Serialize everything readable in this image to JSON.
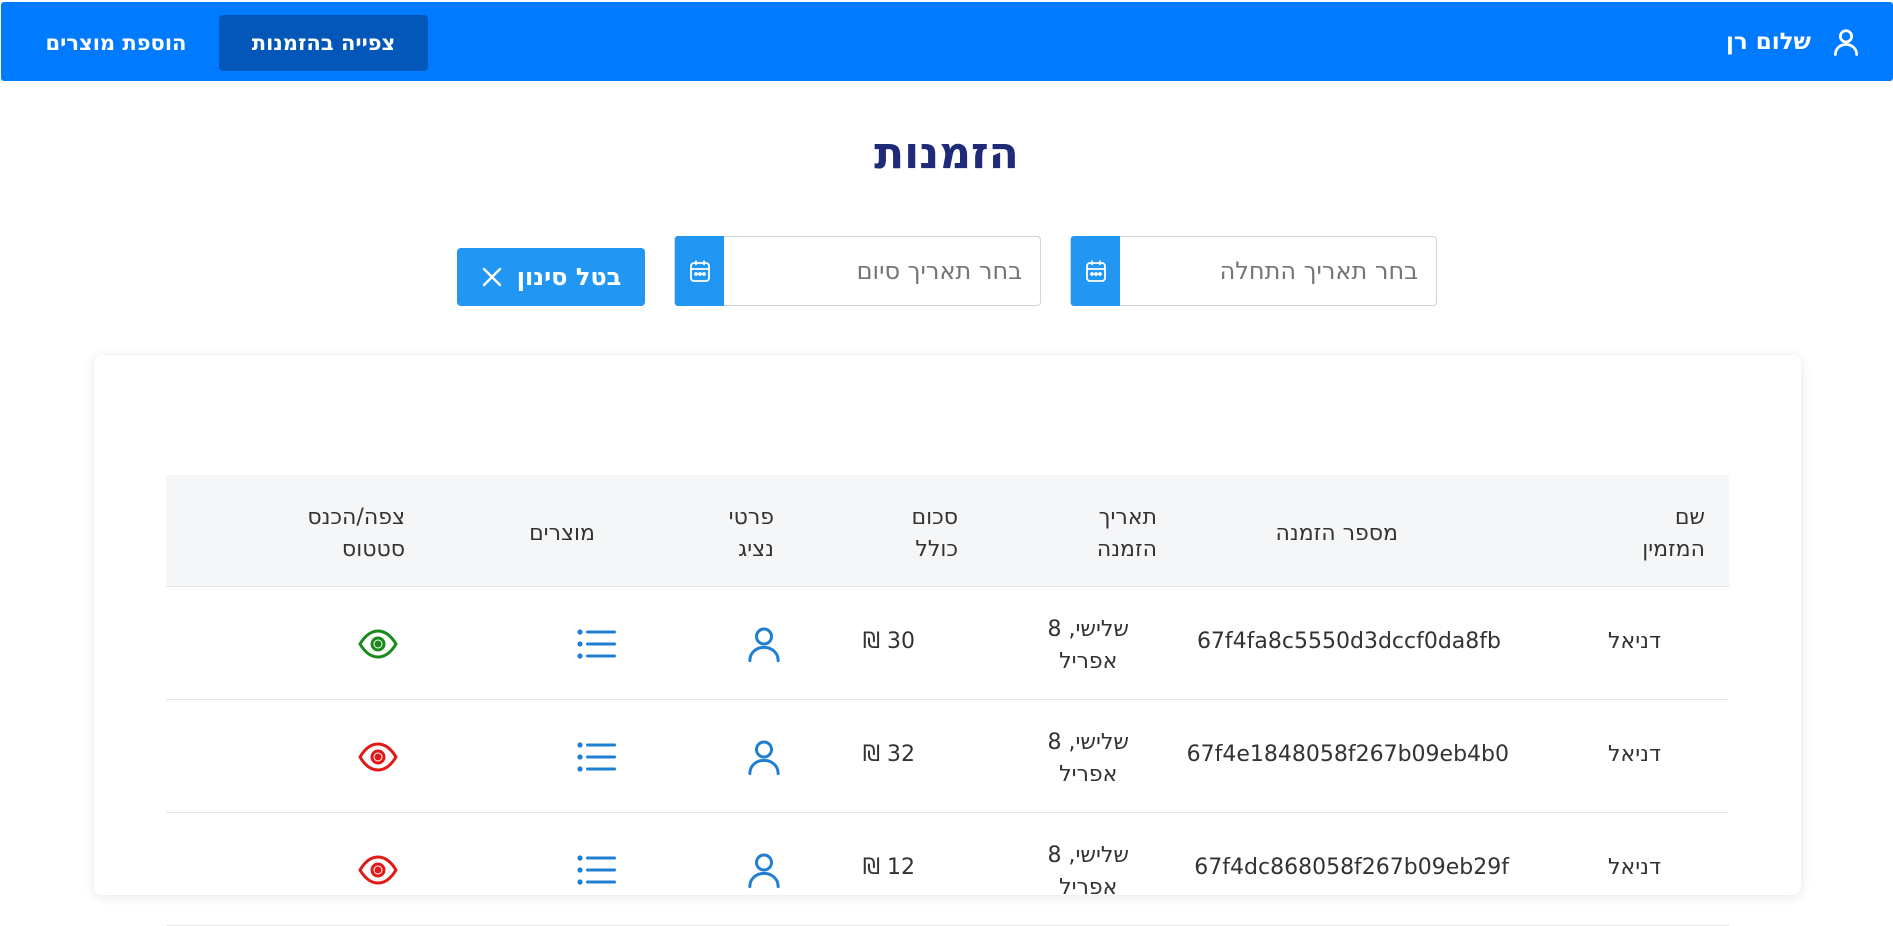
{
  "navbar": {
    "user_name": "שלום רן",
    "view_orders_label": "צפייה בהזמנות",
    "add_products_label": "הוספת מוצרים"
  },
  "page": {
    "title": "הזמנות"
  },
  "filters": {
    "start_date_placeholder": "בחר תאריך התחלה",
    "end_date_placeholder": "בחר תאריך סיום",
    "clear_label": "בטל סינון"
  },
  "table": {
    "headers": {
      "customer_name": [
        "שם",
        "המזמין"
      ],
      "order_number": "מספר הזמנה",
      "order_date": [
        "תאריך",
        "הזמנה"
      ],
      "total": [
        "סכום",
        "כולל"
      ],
      "rep": [
        "פרטי",
        "נציג"
      ],
      "products": "מוצרים",
      "status": [
        "צפה/הכנס",
        "סטטוס"
      ]
    },
    "rows": [
      {
        "customer": "דניאל",
        "order_id": "67f4fa8c5550d3dccf0da8fb",
        "date_line1": "שלישי, 8",
        "date_line2": "אפריל",
        "total": "30 ₪",
        "status_color": "#1a8a1a"
      },
      {
        "customer": "דניאל",
        "order_id": "67f4e1848058f267b09eb4b0",
        "date_line1": "שלישי, 8",
        "date_line2": "אפריל",
        "total": "32 ₪",
        "status_color": "#e01919"
      },
      {
        "customer": "דניאל",
        "order_id": "67f4dc868058f267b09eb29f",
        "date_line1": "שלישי, 8",
        "date_line2": "אפריל",
        "total": "12 ₪",
        "status_color": "#e01919"
      }
    ]
  },
  "colors": {
    "navbar": "#007bff",
    "active_nav": "#0257b8",
    "primary_button": "#2196f3",
    "title": "#1f2a79",
    "icon_blue": "#1f7fd1"
  },
  "icons": {
    "user": "user-icon",
    "calendar": "calendar-icon",
    "close": "close-icon",
    "list": "list-icon",
    "eye": "eye-icon"
  }
}
